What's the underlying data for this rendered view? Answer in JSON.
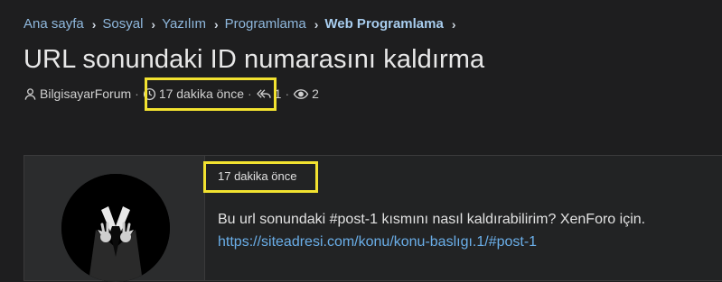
{
  "breadcrumb": {
    "items": [
      "Ana sayfa",
      "Sosyal",
      "Yazılım",
      "Programlama"
    ],
    "current": "Web Programlama"
  },
  "thread": {
    "title": "URL sonundaki ID numarasını kaldırma",
    "author": "BilgisayarForum",
    "time": "17 dakika önce",
    "replies": "1",
    "views": "2"
  },
  "post": {
    "time": "17 dakika önce",
    "text": "Bu url sonundaki #post-1 kısmını nasıl kaldırabilirim? XenForo için.",
    "link": "https://siteadresi.com/konu/konu-baslıgı.1/#post-1"
  },
  "icons": {
    "author": "user-icon",
    "time": "clock-icon",
    "replies": "reply-icon",
    "views": "eye-icon"
  },
  "colors": {
    "background": "#1e1e1f",
    "link": "#6aaee8",
    "breadcrumb": "#8fb8dd",
    "highlight": "#f2e230"
  }
}
